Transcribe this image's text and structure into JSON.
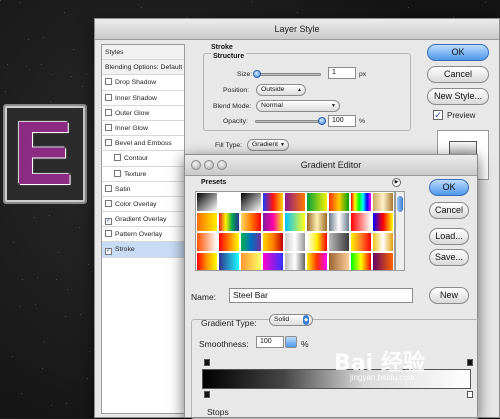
{
  "layer_style": {
    "title": "Layer Style",
    "styles_header": "Styles",
    "items": [
      {
        "label": "Blending Options: Default",
        "type": "hdr",
        "checked": false
      },
      {
        "label": "Drop Shadow",
        "type": "item",
        "checked": false
      },
      {
        "label": "Inner Shadow",
        "type": "item",
        "checked": false
      },
      {
        "label": "Outer Glow",
        "type": "item",
        "checked": false
      },
      {
        "label": "Inner Glow",
        "type": "item",
        "checked": false
      },
      {
        "label": "Bevel and Emboss",
        "type": "item",
        "checked": false
      },
      {
        "label": "Contour",
        "type": "sub",
        "checked": false
      },
      {
        "label": "Texture",
        "type": "sub",
        "checked": false
      },
      {
        "label": "Satin",
        "type": "item",
        "checked": false
      },
      {
        "label": "Color Overlay",
        "type": "item",
        "checked": false
      },
      {
        "label": "Gradient Overlay",
        "type": "item",
        "checked": true
      },
      {
        "label": "Pattern Overlay",
        "type": "item",
        "checked": false
      },
      {
        "label": "Stroke",
        "type": "item",
        "checked": true,
        "selected": true
      }
    ],
    "stroke_title": "Stroke",
    "structure_title": "Structure",
    "size_label": "Size:",
    "size_value": "1",
    "size_unit": "px",
    "position_label": "Position:",
    "position_value": "Outside",
    "blend_label": "Blend Mode:",
    "blend_value": "Normal",
    "opacity_label": "Opacity:",
    "opacity_value": "100",
    "opacity_unit": "%",
    "filltype_label": "Fill Type:",
    "filltype_value": "Gradient",
    "ok": "OK",
    "cancel": "Cancel",
    "new_style": "New Style...",
    "preview_label": "Preview",
    "preview_checked": "✓"
  },
  "gradient_editor": {
    "title": "Gradient Editor",
    "presets_label": "Presets",
    "ok": "OK",
    "cancel": "Cancel",
    "load": "Load...",
    "save": "Save...",
    "name_label": "Name:",
    "name_value": "Steel Bar",
    "new": "New",
    "gradient_type_label": "Gradient Type:",
    "gradient_type_value": "Solid",
    "smoothness_label": "Smoothness:",
    "smoothness_value": "100",
    "smoothness_unit": "%",
    "stops_label": "Stops",
    "preset_swatches": [
      "linear-gradient(135deg,#000,#fff)",
      "linear-gradient(135deg,#fff,transparent)",
      "linear-gradient(135deg,#000,transparent)",
      "linear-gradient(90deg,#1a3cff,#ff1414,#ffd800)",
      "linear-gradient(90deg,#8b1a8b,#ff7a00)",
      "linear-gradient(90deg,#00a13a,#f7f300)",
      "linear-gradient(90deg,#ff2e00,#ffcc00,#00a300)",
      "linear-gradient(90deg,#ff0000,#ffff00,#00ff00,#00ffff,#0000ff,#ff00ff)",
      "linear-gradient(90deg,#d0a860,#fff2c8,#a8792e)",
      "linear-gradient(90deg,#ff6d00,#fff200)",
      "linear-gradient(90deg,#e31e24,#fff200,#00a651,#2e3192)",
      "linear-gradient(90deg,#ffd966,#ff7b00,#ff0000)",
      "linear-gradient(90deg,#7c1ea0,#ff00a8,#ffea00)",
      "linear-gradient(90deg,#00c3ff,#ffff1c)",
      "linear-gradient(90deg,#9c6b2b,#fff1b0,#9c6b2b)",
      "linear-gradient(90deg,#6e7b8b,#fff,#6e7b8b)",
      "linear-gradient(90deg,#ff0000,transparent)",
      "linear-gradient(90deg,#0000ff,#ff0000,#ffff00)",
      "linear-gradient(90deg,#ff5400,#ffffff)",
      "linear-gradient(90deg,#ff0000,#ffff00)",
      "linear-gradient(90deg,#00b050,#0070c0,#7030a0)",
      "linear-gradient(90deg,#ffd400,#ff7e00,#c00000)",
      "linear-gradient(90deg,#ccc,#fff,#999)",
      "linear-gradient(90deg,#fff,#ffee00,#ff0000)",
      "linear-gradient(90deg,#b9b9b9,#3c3c3c)",
      "linear-gradient(90deg,#fff200,#ff7f27,#ff0000)",
      "linear-gradient(90deg,#f0c418,#fff,#e3a10b)",
      "linear-gradient(90deg,#ff0000,#ff9900,#ffff00)",
      "linear-gradient(90deg,#2e3192,#1bffff)",
      "linear-gradient(90deg,#ff9933,#ffff66)",
      "linear-gradient(90deg,#ff00cc,#3333ff)",
      "linear-gradient(90deg,#bebebe,#ffffff,#646464)",
      "linear-gradient(90deg,#ffee00,#ff3300,#ff00ff)",
      "linear-gradient(90deg,#996633,#ffcc99)",
      "linear-gradient(90deg,#00ff00,#ffff00,#ff0000)",
      "linear-gradient(90deg,#660066,#ff6600)"
    ]
  },
  "watermark": {
    "brand": "Bai 经验",
    "site": "jingyan.baidu.com"
  },
  "canvas": {
    "letter": "E"
  }
}
